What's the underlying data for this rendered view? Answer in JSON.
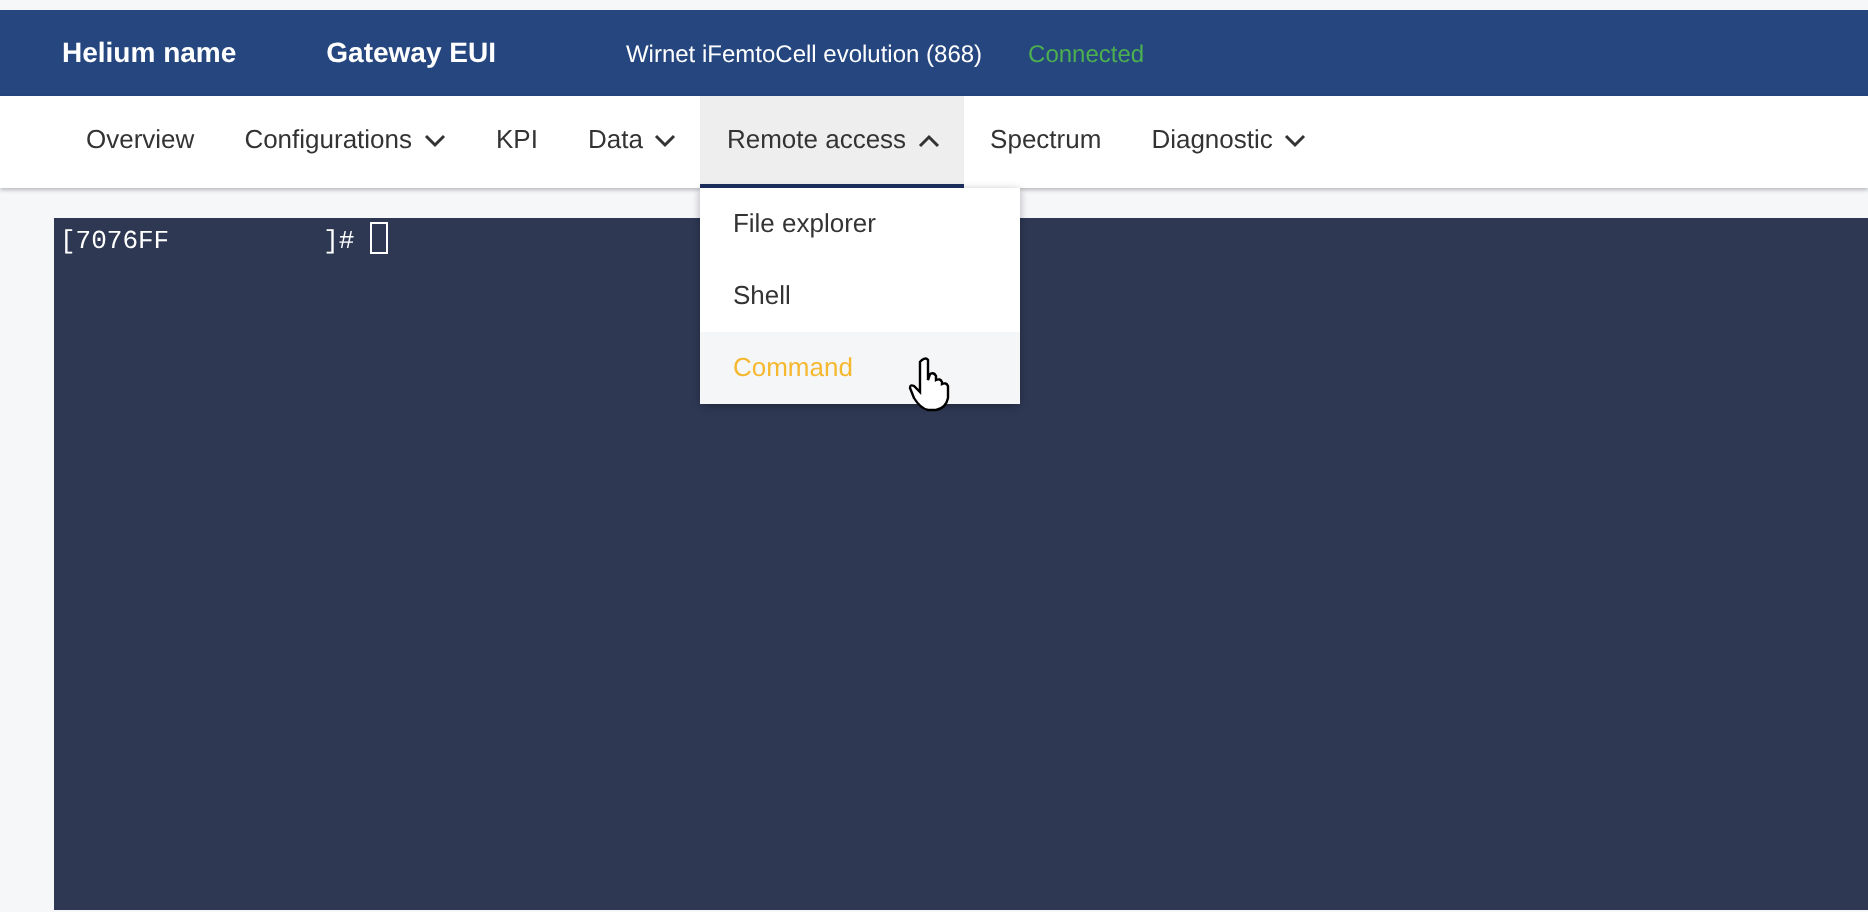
{
  "header": {
    "helium_name": "Helium name",
    "gateway_eui": "Gateway EUI",
    "model": "Wirnet iFemtoCell evolution (868)",
    "status": "Connected"
  },
  "nav": [
    {
      "label": "Overview",
      "dropdown": false,
      "expanded": false
    },
    {
      "label": "Configurations",
      "dropdown": true,
      "expanded": false
    },
    {
      "label": "KPI",
      "dropdown": false,
      "expanded": false
    },
    {
      "label": "Data",
      "dropdown": true,
      "expanded": false
    },
    {
      "label": "Remote access",
      "dropdown": true,
      "expanded": true,
      "menu": [
        {
          "label": "File explorer",
          "selected": false
        },
        {
          "label": "Shell",
          "selected": false
        },
        {
          "label": "Command",
          "selected": true
        }
      ]
    },
    {
      "label": "Spectrum",
      "dropdown": false,
      "expanded": false
    },
    {
      "label": "Diagnostic",
      "dropdown": true,
      "expanded": false
    }
  ],
  "terminal": {
    "host": "[7076FF",
    "prompt": "]#"
  }
}
